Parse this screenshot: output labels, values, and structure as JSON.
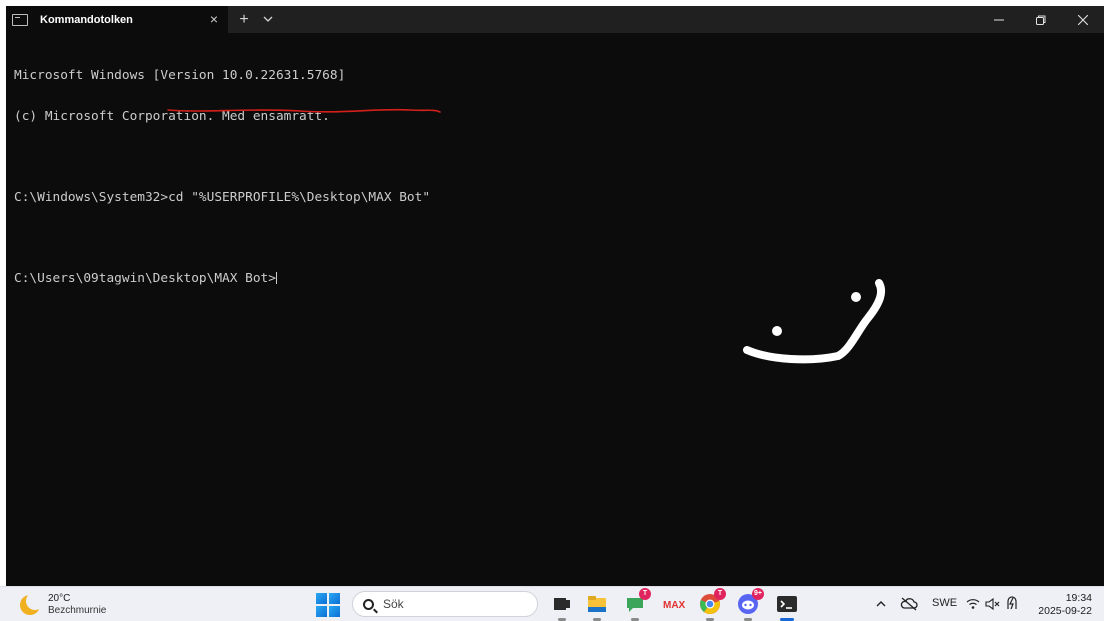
{
  "window": {
    "tab_title": "Kommandotolken",
    "tab_close": "×",
    "new_tab": "+",
    "tab_dropdown": "⌄",
    "minimize": "—",
    "maximize": "❐",
    "close": "✕"
  },
  "terminal": {
    "lines": [
      "Microsoft Windows [Version 10.0.22631.5768]",
      "(c) Microsoft Corporation. Med ensamrätt.",
      "",
      "",
      ""
    ],
    "prompt1": "C:\\Windows\\System32>",
    "command1": "cd \"%USERPROFILE%\\Desktop\\MAX Bot\"",
    "prompt2": "C:\\Users\\09tagwin\\Desktop\\MAX Bot>"
  },
  "annotation": {
    "underline_color": "#d4201a",
    "drawing_color": "#ffffff"
  },
  "taskbar": {
    "weather_temp": "20°C",
    "weather_desc": "Bezchmurnie",
    "search_placeholder": "Sök",
    "apps": [
      {
        "icon": "task-view-icon"
      },
      {
        "icon": "file-explorer-icon"
      },
      {
        "icon": "teams-chat-icon",
        "badge": "T"
      },
      {
        "icon": "max-app-icon"
      },
      {
        "icon": "chrome-icon",
        "badge": "T"
      },
      {
        "icon": "discord-icon",
        "badge": "9+"
      },
      {
        "icon": "terminal-icon"
      }
    ],
    "tray_chevron": "^",
    "language": "SWE",
    "time": "19:34",
    "date": "2025-09-22"
  }
}
